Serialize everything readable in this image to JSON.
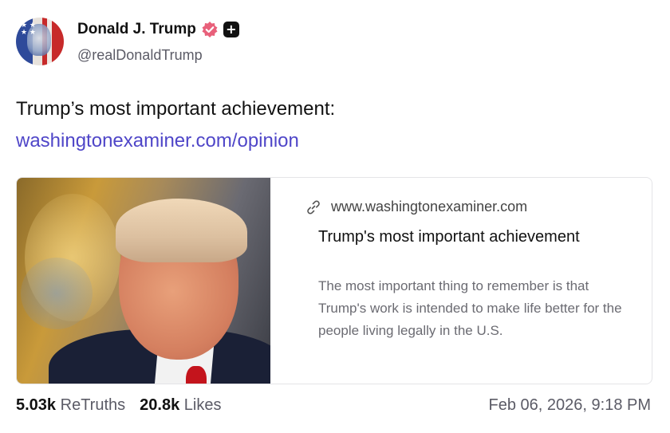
{
  "author": {
    "display_name": "Donald J. Trump",
    "handle": "@realDonaldTrump",
    "verified_icon": "verified-badge-icon",
    "badge_icon": "plus-icon"
  },
  "post": {
    "text": "Trump’s most important achievement:",
    "link_text": "washingtonexaminer.com/opinion"
  },
  "card": {
    "domain": "www.washingtonexaminer.com",
    "title": "Trump's most important achievement",
    "description": "The most important thing to remember is that Trump's work is intended to make life better for the people living legally in the U.S."
  },
  "stats": {
    "retruths_count": "5.03k",
    "retruths_label": "ReTruths",
    "likes_count": "20.8k",
    "likes_label": "Likes"
  },
  "timestamp": "Feb 06, 2026, 9:18 PM",
  "colors": {
    "link": "#4f46c8",
    "verified": "#e8607a",
    "muted": "#5b5b66"
  }
}
